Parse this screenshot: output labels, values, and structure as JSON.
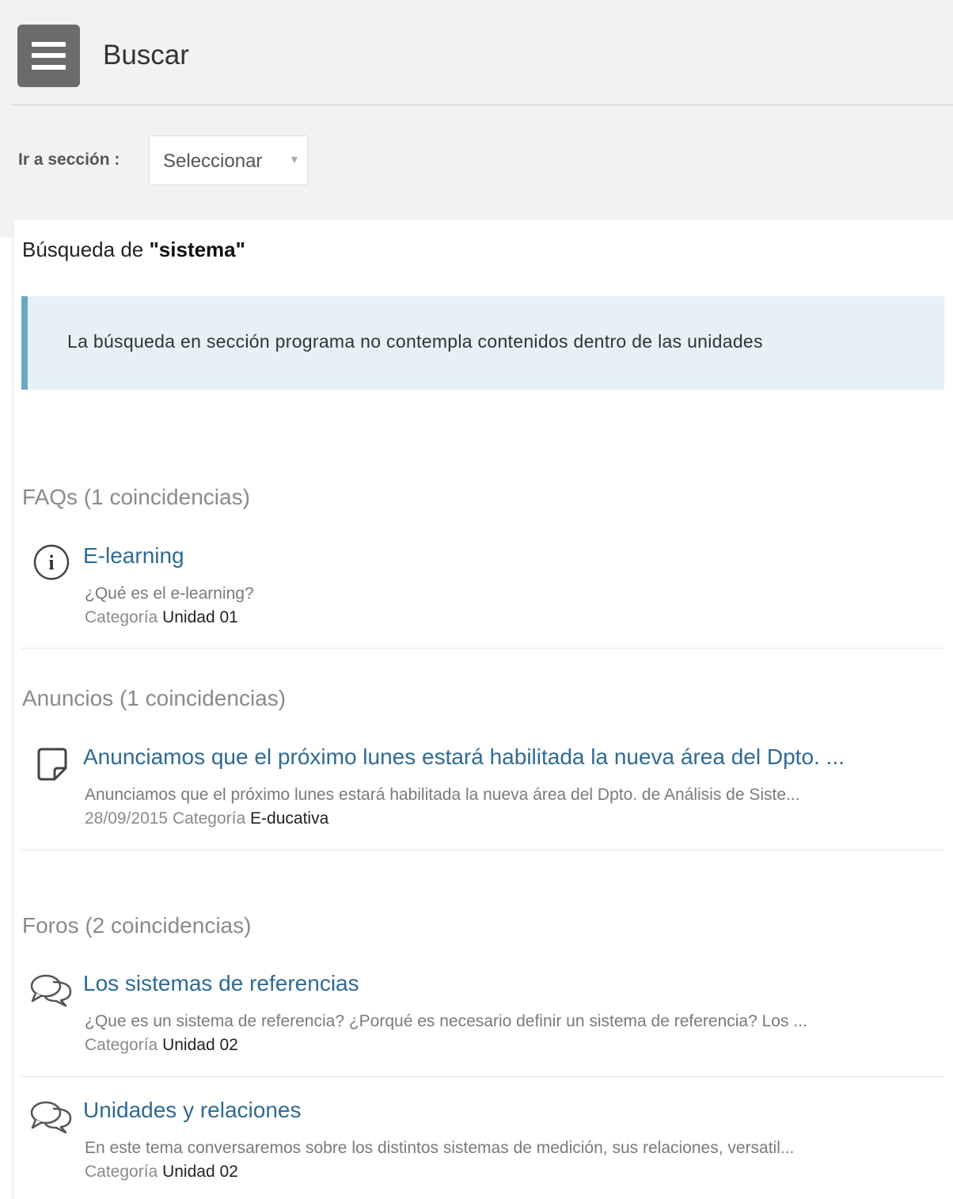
{
  "header": {
    "title": "Buscar"
  },
  "section_nav": {
    "label": "Ir a sección :",
    "selected": "Seleccionar"
  },
  "search": {
    "prefix": "Búsqueda de ",
    "term": "\"sistema\""
  },
  "notice": "La búsqueda en sección programa no contempla contenidos dentro de las unidades",
  "groups": {
    "faqs": {
      "title": "FAQs (1 coincidencias)",
      "items": [
        {
          "title": "E-learning",
          "excerpt": "¿Qué es el e-learning?",
          "date": "",
          "category_label": "Categoría",
          "category": "Unidad 01",
          "icon": "info-icon"
        }
      ]
    },
    "anuncios": {
      "title": "Anuncios (1 coincidencias)",
      "items": [
        {
          "title": "Anunciamos que el próximo lunes estará habilitada la nueva área del Dpto. ...",
          "excerpt": "Anunciamos que el próximo lunes estará habilitada la nueva área del Dpto. de Análisis de Siste...",
          "date": "28/09/2015",
          "category_label": "Categoría",
          "category": "E-ducativa",
          "icon": "note-icon"
        }
      ]
    },
    "foros": {
      "title": "Foros (2 coincidencias)",
      "items": [
        {
          "title": "Los sistemas de referencias",
          "excerpt": "¿Que es un sistema de referencia? ¿Porqué es necesario definir un sistema de referencia? Los ...",
          "date": "",
          "category_label": "Categoría",
          "category": "Unidad 02",
          "icon": "chat-bubbles-icon"
        },
        {
          "title": "Unidades y relaciones",
          "excerpt": "En este tema conversaremos sobre los distintos sistemas de medición, sus relaciones, versatil...",
          "date": "",
          "category_label": "Categoría",
          "category": "Unidad 02",
          "icon": "chat-bubbles-icon"
        }
      ]
    }
  },
  "colors": {
    "link": "#2f6a94",
    "notice_bg": "#e5f1f6",
    "notice_border": "#6aaabf",
    "menu_button": "#6b6b6b"
  }
}
